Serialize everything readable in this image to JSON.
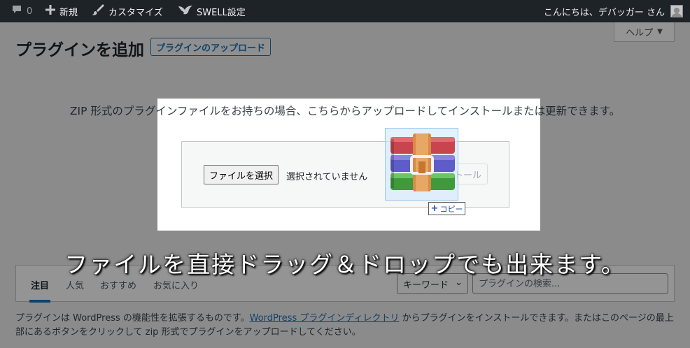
{
  "admin_bar": {
    "comments_count": "0",
    "new_label": "新規",
    "customize_label": "カスタマイズ",
    "swell_label": "SWELL設定",
    "greeting": "こんにちは、デバッガー さん"
  },
  "help_label": "ヘルプ",
  "page": {
    "title": "プラグインを追加",
    "upload_button": "プラグインのアップロード",
    "upload_help": "ZIP 形式のプラグインファイルをお持ちの場合、こちらからアップロードしてインストールまたは更新できます。"
  },
  "upload_form": {
    "file_button": "ファイルを選択",
    "file_status": "選択されていません",
    "install_button": "今すぐインストール"
  },
  "drag": {
    "file_icon": "winrar-archive-icon",
    "copy_label": "コピー"
  },
  "filter": {
    "tabs": [
      "注目",
      "人気",
      "おすすめ",
      "お気に入り"
    ],
    "search_type": "キーワード",
    "search_placeholder": "プラグインの検索..."
  },
  "description": {
    "part1": "プラグインは WordPress の機能性を拡張するものです。",
    "link": "WordPress プラグインディレクトリ",
    "part2": " からプラグインをインストールできます。またはこのページの最上部にあるボタンをクリックして zip 形式でプラグインをアップロードしてください。"
  },
  "caption": "ファイルを直接ドラッグ＆ドロップでも出来ます。",
  "colors": {
    "admin_bar": "#1d2327",
    "accent": "#2271b1",
    "background": "#f0f0f1"
  }
}
